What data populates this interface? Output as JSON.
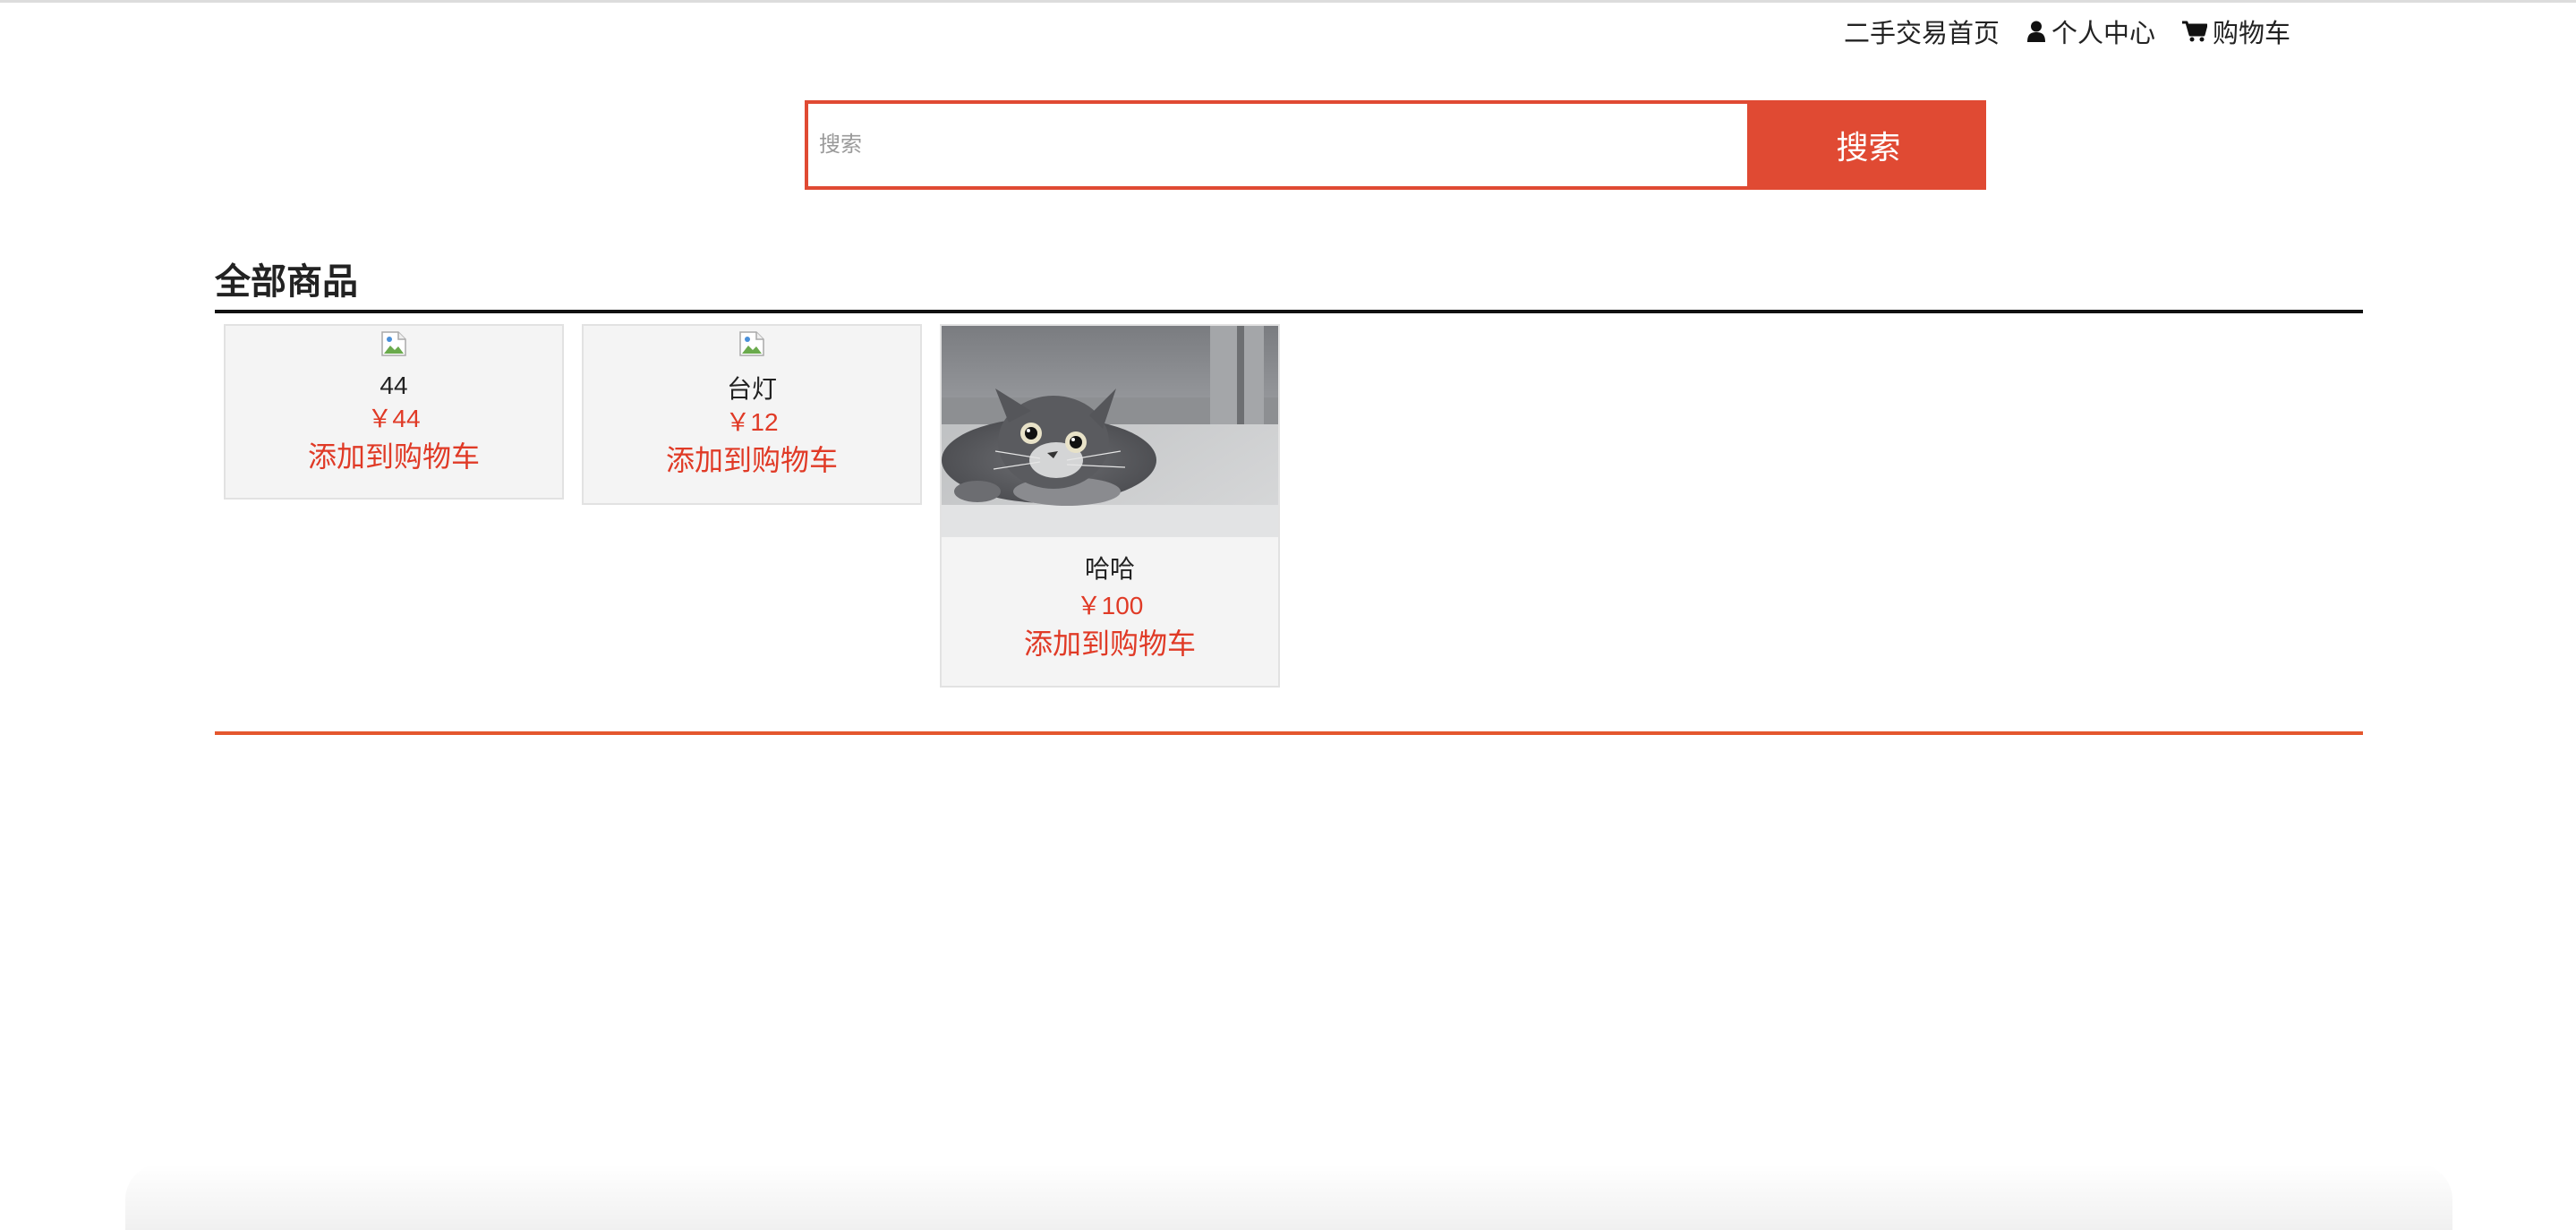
{
  "nav": {
    "home": "二手交易首页",
    "profile": "个人中心",
    "cart": "购物车",
    "icons": [
      "user-icon",
      "cart-icon"
    ]
  },
  "search": {
    "placeholder": "搜索",
    "value": "",
    "button_label": "搜索"
  },
  "section": {
    "title": "全部商品"
  },
  "products": [
    {
      "name": "44",
      "price": "￥44",
      "add_label": "添加到购物车",
      "image": "broken-image"
    },
    {
      "name": "台灯",
      "price": "￥12",
      "add_label": "添加到购物车",
      "image": "broken-image"
    },
    {
      "name": "哈哈",
      "price": "￥100",
      "add_label": "添加到购物车",
      "image": "cat-photo"
    }
  ],
  "colors": {
    "accent": "#e04a33",
    "price": "#e03a26",
    "card_bg": "#f4f4f4"
  }
}
